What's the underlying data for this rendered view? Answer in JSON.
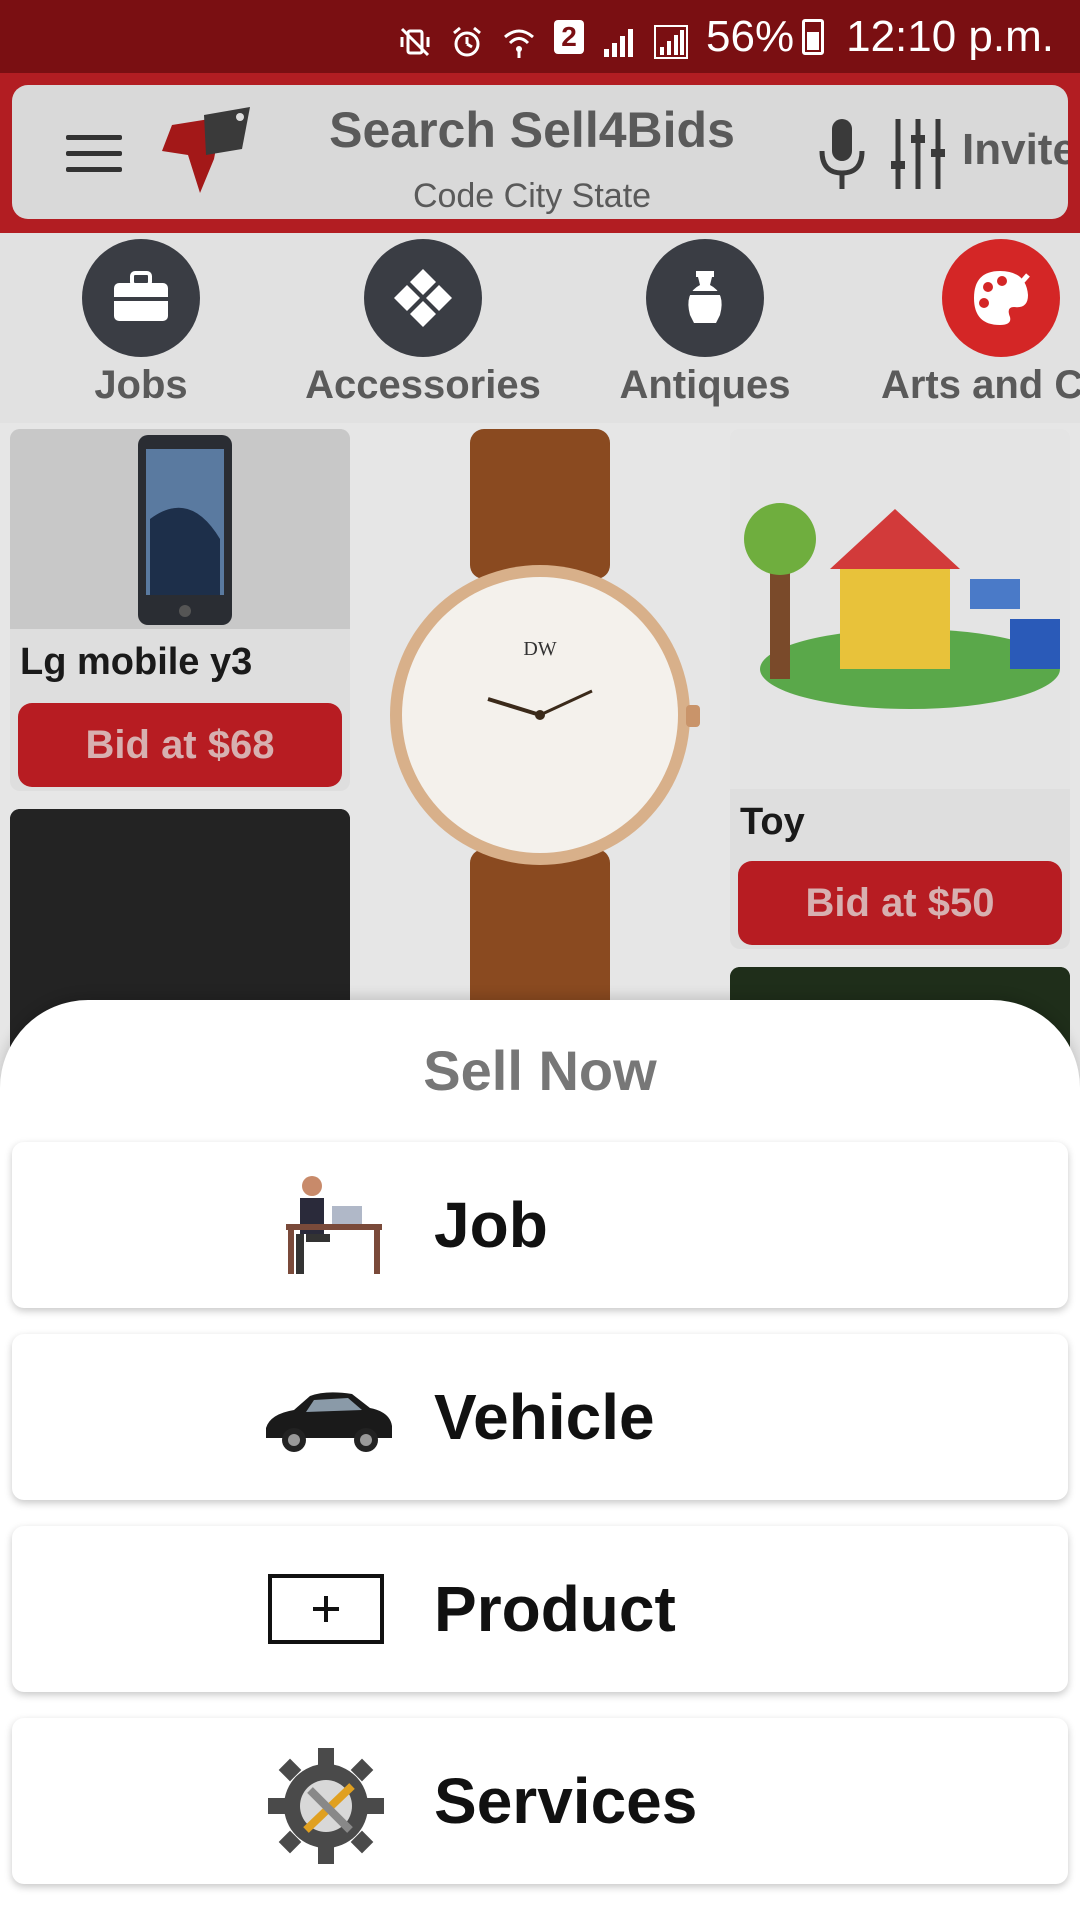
{
  "status_bar": {
    "battery": "56%",
    "sim_slot": "2",
    "time": "12:10 p.m."
  },
  "header": {
    "search_title": "Search Sell4Bids",
    "search_subtitle": "Code City State",
    "invite_label": "Invite",
    "brand_color": "#b21d22"
  },
  "categories": [
    {
      "label": "Jobs",
      "icon": "briefcase-icon"
    },
    {
      "label": "Accessories",
      "icon": "diamond-icon"
    },
    {
      "label": "Antiques",
      "icon": "vase-icon"
    },
    {
      "label": "Arts and Cra",
      "icon": "palette-icon",
      "active": true
    }
  ],
  "products": [
    {
      "title": "Lg mobile y3",
      "bid_label": "Bid at $68"
    },
    {
      "title": "",
      "bid_label": ""
    },
    {
      "title": "Toy",
      "bid_label": "Bid at $50"
    }
  ],
  "sheet": {
    "title": "Sell Now",
    "options": [
      {
        "label": "Job",
        "icon": "job-person-desk-icon"
      },
      {
        "label": "Vehicle",
        "icon": "car-icon"
      },
      {
        "label": "Product",
        "icon": "add-product-icon"
      },
      {
        "label": "Services",
        "icon": "services-gear-icon"
      }
    ]
  }
}
